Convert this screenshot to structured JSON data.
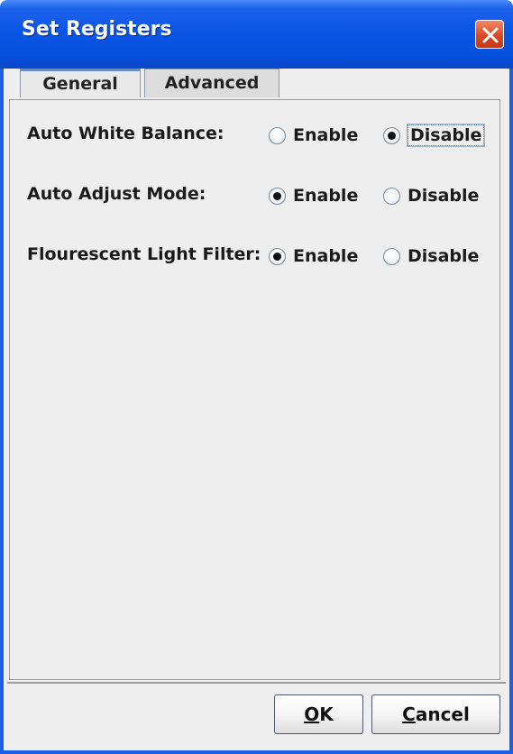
{
  "window": {
    "title": "Set Registers",
    "close_icon": "close-x-icon"
  },
  "tabs": [
    {
      "label": "General",
      "selected": true
    },
    {
      "label": "Advanced",
      "selected": false
    }
  ],
  "settings": [
    {
      "label": "Auto White Balance:",
      "options": [
        "Enable",
        "Disable"
      ],
      "selected": "Disable",
      "focused": "Disable"
    },
    {
      "label": "Auto Adjust Mode:",
      "options": [
        "Enable",
        "Disable"
      ],
      "selected": "Enable"
    },
    {
      "label": "Flourescent Light Filter:",
      "options": [
        "Enable",
        "Disable"
      ],
      "selected": "Enable"
    }
  ],
  "buttons": {
    "ok": {
      "mnemonic": "O",
      "rest": "K"
    },
    "cancel": {
      "mnemonic": "C",
      "rest": "ancel"
    }
  },
  "colors": {
    "titlebar": "#0b55e6",
    "close_button": "#d94a25",
    "panel_bg": "#eeeeee"
  }
}
